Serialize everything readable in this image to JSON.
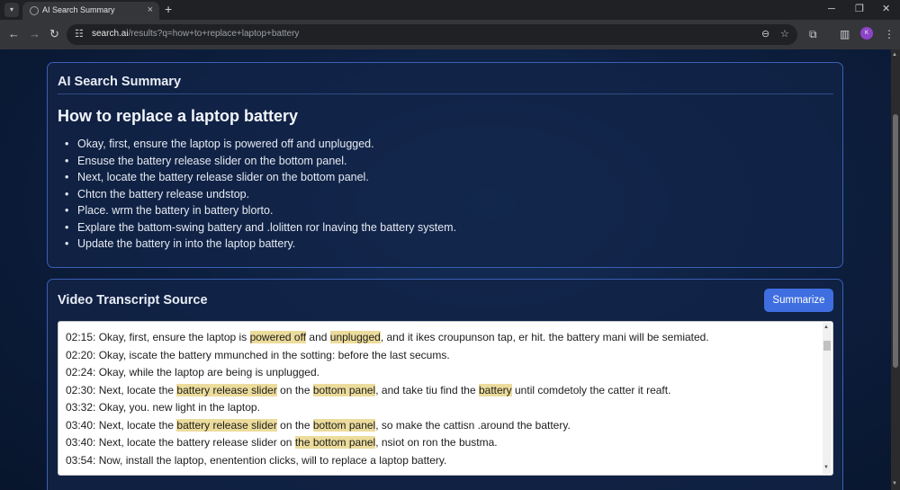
{
  "browser": {
    "tab_title": "AI Search Summary",
    "tab_close": "×",
    "new_tab": "+",
    "url_host": "search.ai",
    "url_path": "/results?q=how+to+replace+laptop+battery",
    "profile_initials": "K",
    "icons": [
      "tab-search-icon",
      "favicon-icon",
      "back-icon",
      "forward-icon",
      "reload-icon",
      "site-info-icon",
      "zoom-icon",
      "bookmark-star-icon",
      "extensions-icon",
      "side-panel-icon",
      "menu-icon",
      "minimize-icon",
      "restore-icon",
      "close-window-icon"
    ]
  },
  "summary": {
    "heading": "AI Search Summary",
    "title": "How to replace a laptop battery",
    "items": [
      "Okay, first, ensure the laptop is powered off and unplugged.",
      "Ensuse the battery release slider on the bottom panel.",
      "Next, locate the battery release slider on the bottom panel.",
      "Chtcn the battery release undstop.",
      "Place. wrm the battery in battery blorto.",
      "Explare the battom-swing battery and .lolitten ror lnaving the battery system.",
      "Update the battery in into the laptop battery."
    ]
  },
  "transcript": {
    "heading": "Video Transcript Source",
    "summarize_label": "Summarize",
    "lines": [
      [
        {
          "text": "02:15: Okay, first, ensure the laptop is "
        },
        {
          "text": "powered off",
          "hl": true
        },
        {
          "text": " and "
        },
        {
          "text": "unplugged",
          "hl": true
        },
        {
          "text": ", and it ikes croupunson tap, er hit. the battery mani will be semiated."
        }
      ],
      [
        {
          "text": "02:20: Okay, iscate the battery mmunched in the sotting: before the last secums."
        }
      ],
      [
        {
          "text": "02:24: Okay, while the laptop are being is unplugged."
        }
      ],
      [
        {
          "text": "02:30: Next, locate the "
        },
        {
          "text": "battery release slider",
          "hl": true
        },
        {
          "text": " on the "
        },
        {
          "text": "bottom panel",
          "hl": true
        },
        {
          "text": ", and take tiu find the "
        },
        {
          "text": "battery",
          "hl": true
        },
        {
          "text": " until comdetoly the catter it reaft."
        }
      ],
      [
        {
          "text": "03:32: Okay, you. new light in the laptop."
        }
      ],
      [
        {
          "text": "03:40: Next, locate the "
        },
        {
          "text": "battery release slider",
          "hl": true
        },
        {
          "text": " on the "
        },
        {
          "text": "bottom panel",
          "hl": true
        },
        {
          "text": ", so make the cattisn .around the battery."
        }
      ],
      [
        {
          "text": "03:40: Next, locate the battery release slider on "
        },
        {
          "text": "the bottom panel",
          "hl": true
        },
        {
          "text": ", nsiot on ron the bustma."
        }
      ],
      [
        {
          "text": "03:54: Now, install the laptop, enentention clicks, will to replace a laptop battery."
        }
      ]
    ]
  },
  "colors": {
    "accent": "#3f6ee0",
    "highlight": "#ecdc9c",
    "card_border": "#3a5fb5",
    "page_background": "#0b1a33"
  }
}
